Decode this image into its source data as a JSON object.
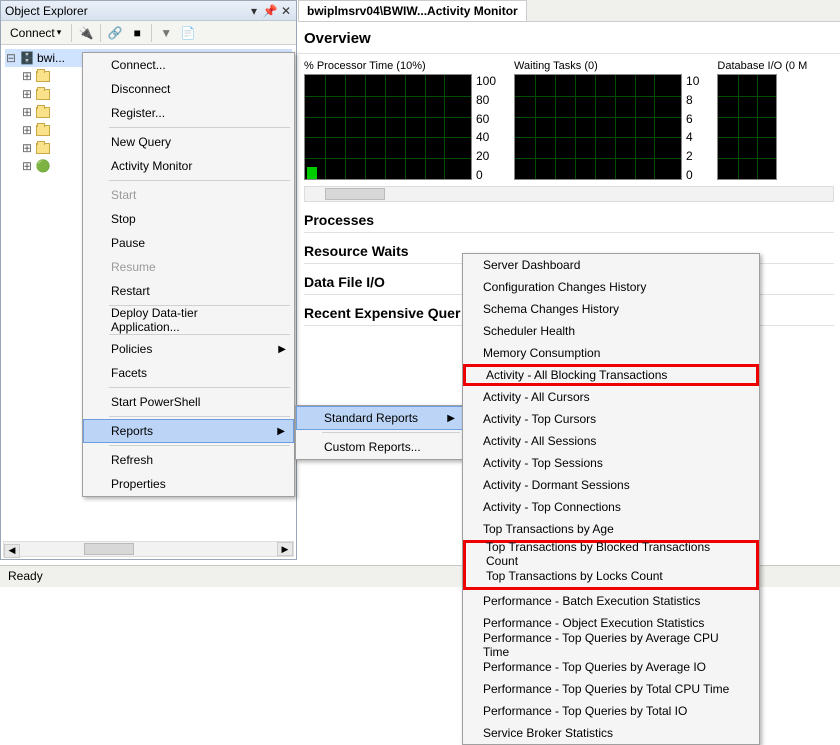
{
  "object_explorer": {
    "title": "Object Explorer",
    "connect_label": "Connect",
    "tree": {
      "root_name": "bwi..."
    }
  },
  "context_menu": {
    "items": [
      {
        "label": "Connect...",
        "enabled": true
      },
      {
        "label": "Disconnect",
        "enabled": true
      },
      {
        "label": "Register...",
        "enabled": true
      },
      {
        "divider": true
      },
      {
        "label": "New Query",
        "enabled": true
      },
      {
        "label": "Activity Monitor",
        "enabled": true
      },
      {
        "divider": true
      },
      {
        "label": "Start",
        "enabled": false
      },
      {
        "label": "Stop",
        "enabled": true
      },
      {
        "label": "Pause",
        "enabled": true
      },
      {
        "label": "Resume",
        "enabled": false
      },
      {
        "label": "Restart",
        "enabled": true
      },
      {
        "divider": true
      },
      {
        "label": "Deploy Data-tier Application...",
        "enabled": true
      },
      {
        "divider": true
      },
      {
        "label": "Policies",
        "enabled": true,
        "submenu": true
      },
      {
        "label": "Facets",
        "enabled": true
      },
      {
        "divider": true
      },
      {
        "label": "Start PowerShell",
        "enabled": true
      },
      {
        "divider": true
      },
      {
        "label": "Reports",
        "enabled": true,
        "submenu": true,
        "highlighted": true
      },
      {
        "divider": true
      },
      {
        "label": "Refresh",
        "enabled": true
      },
      {
        "label": "Properties",
        "enabled": true
      }
    ]
  },
  "reports_submenu": {
    "items": [
      {
        "label": "Standard Reports",
        "submenu": true,
        "highlighted": true
      },
      {
        "label": "Custom Reports...",
        "submenu": false
      }
    ]
  },
  "standard_reports": {
    "items": [
      "Server Dashboard",
      "Configuration Changes History",
      "Schema Changes History",
      "Scheduler Health",
      "Memory Consumption",
      "Activity - All Blocking Transactions",
      "Activity - All Cursors",
      "Activity - Top Cursors",
      "Activity - All Sessions",
      "Activity - Top Sessions",
      "Activity - Dormant Sessions",
      "Activity - Top Connections",
      "Top Transactions by Age",
      "Top Transactions by Blocked Transactions Count",
      "Top Transactions by Locks Count",
      "Performance - Batch Execution Statistics",
      "Performance - Object Execution Statistics",
      "Performance - Top Queries by Average CPU Time",
      "Performance - Top Queries by Average IO",
      "Performance - Top Queries by Total CPU Time",
      "Performance - Top Queries by Total IO",
      "Service Broker Statistics"
    ],
    "highlighted_indices": [
      5,
      13,
      14
    ]
  },
  "activity_monitor": {
    "tab_title": "bwiplmsrv04\\BWIW...Activity Monitor",
    "overview": "Overview",
    "charts": [
      {
        "label": "% Processor Time (10%)",
        "axis": [
          "100",
          "80",
          "60",
          "40",
          "20",
          "0"
        ]
      },
      {
        "label": "Waiting Tasks (0)",
        "axis": [
          "10",
          "8",
          "6",
          "4",
          "2",
          "0"
        ]
      },
      {
        "label": "Database I/O (0 M",
        "axis": []
      }
    ],
    "sections": [
      "Processes",
      "Resource Waits",
      "Data File I/O",
      "Recent Expensive Quer"
    ]
  },
  "status": "Ready"
}
